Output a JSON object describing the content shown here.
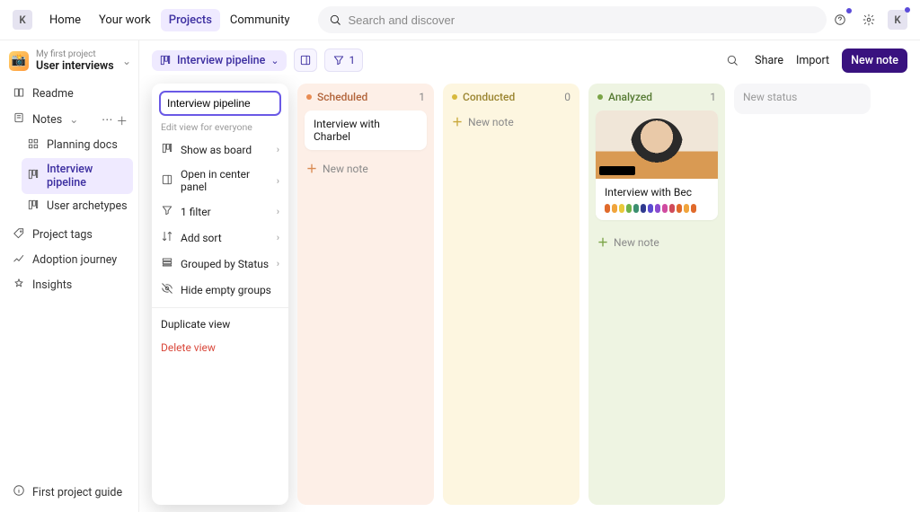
{
  "topbar": {
    "avatar_initial": "K",
    "nav": {
      "home": "Home",
      "your_work": "Your work",
      "projects": "Projects",
      "community": "Community"
    },
    "search_placeholder": "Search and discover"
  },
  "sidebar": {
    "project_sub": "My first project",
    "project_title": "User interviews",
    "readme": "Readme",
    "notes": "Notes",
    "notes_children": {
      "planning": "Planning docs",
      "pipeline": "Interview pipeline",
      "archetypes": "User archetypes"
    },
    "tags": "Project tags",
    "adoption": "Adoption journey",
    "insights": "Insights",
    "guide": "First project guide"
  },
  "toolbar": {
    "view_name": "Interview pipeline",
    "filter_count": "1",
    "share": "Share",
    "import": "Import",
    "new_note": "New note"
  },
  "popover": {
    "input_value": "Interview pipeline",
    "subtitle": "Edit view for everyone",
    "items": {
      "show_as": "Show as board",
      "open_in": "Open in center panel",
      "filter": "1 filter",
      "add_sort": "Add sort",
      "grouped_by": "Grouped by Status",
      "hide_empty": "Hide empty groups"
    },
    "duplicate": "Duplicate view",
    "delete": "Delete view"
  },
  "board": {
    "columns": {
      "scheduled": {
        "name": "Scheduled",
        "count": "1",
        "card": "Interview with Charbel",
        "add": "New note"
      },
      "conducted": {
        "name": "Conducted",
        "count": "0",
        "add": "New note"
      },
      "analyzed": {
        "name": "Analyzed",
        "count": "1",
        "card": "Interview with Bec",
        "add": "New note"
      },
      "newstatus": {
        "name": "New status"
      }
    }
  },
  "tag_colors": [
    "#e06a2b",
    "#f0a43c",
    "#e9c93b",
    "#6fb24a",
    "#3b8f6f",
    "#2f3a8f",
    "#5a4bd0",
    "#8a4bd0",
    "#d04ba0",
    "#d04b5a",
    "#e06a2b",
    "#f0a43c",
    "#e06a2b"
  ]
}
